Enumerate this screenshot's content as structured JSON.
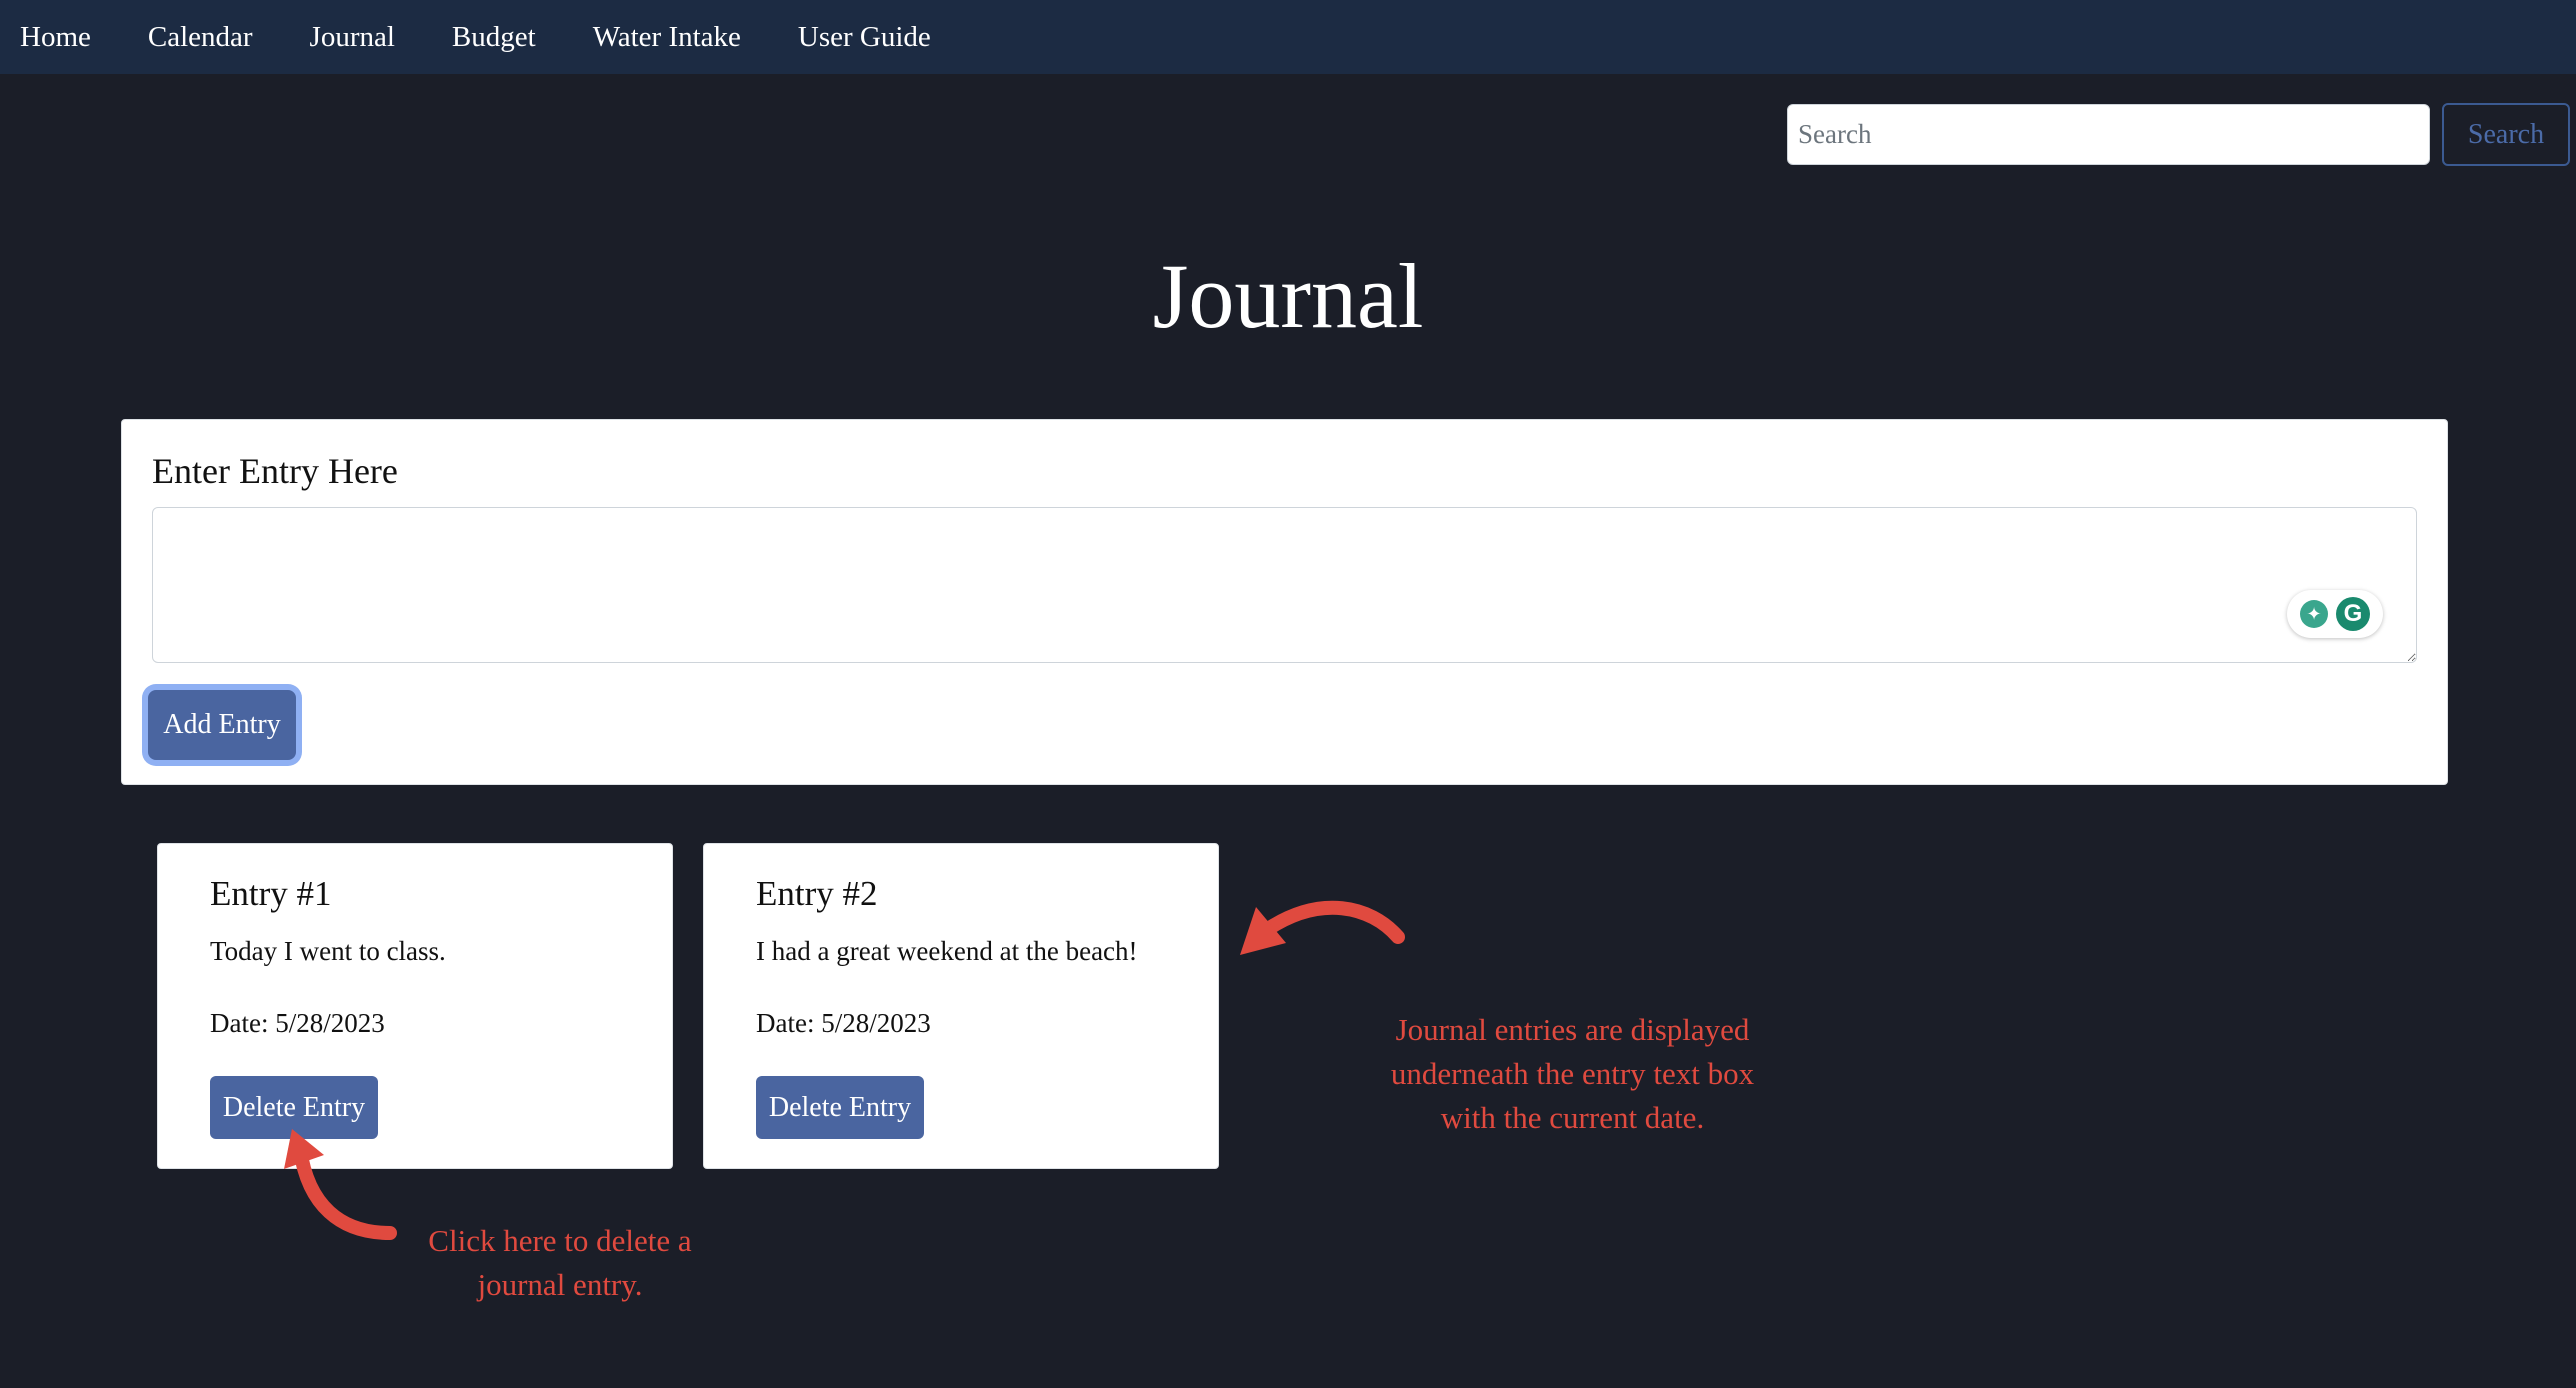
{
  "nav": {
    "items": [
      {
        "label": "Home"
      },
      {
        "label": "Calendar"
      },
      {
        "label": "Journal"
      },
      {
        "label": "Budget"
      },
      {
        "label": "Water Intake"
      },
      {
        "label": "User Guide"
      }
    ]
  },
  "search": {
    "placeholder": "Search",
    "button_label": "Search"
  },
  "page": {
    "title": "Journal"
  },
  "entry_form": {
    "label": "Enter Entry Here",
    "textarea_value": "",
    "add_button_label": "Add Entry"
  },
  "entries": [
    {
      "title": "Entry #1",
      "text": "Today I went to class.",
      "date": "Date: 5/28/2023",
      "delete_label": "Delete Entry"
    },
    {
      "title": "Entry #2",
      "text": "I had a great weekend at the beach!",
      "date": "Date: 5/28/2023",
      "delete_label": "Delete Entry"
    }
  ],
  "annotations": {
    "entries_note": "Journal entries are displayed underneath the entry text box with the current date.",
    "delete_note": "Click here to delete a journal entry."
  },
  "icons": {
    "grammar_bulb": "lightbulb-icon",
    "grammarly": "grammarly-icon"
  },
  "colors": {
    "background": "#1b1e28",
    "navbar": "#1c2b43",
    "button": "#4a65a0",
    "annotation": "#e04a3f"
  }
}
